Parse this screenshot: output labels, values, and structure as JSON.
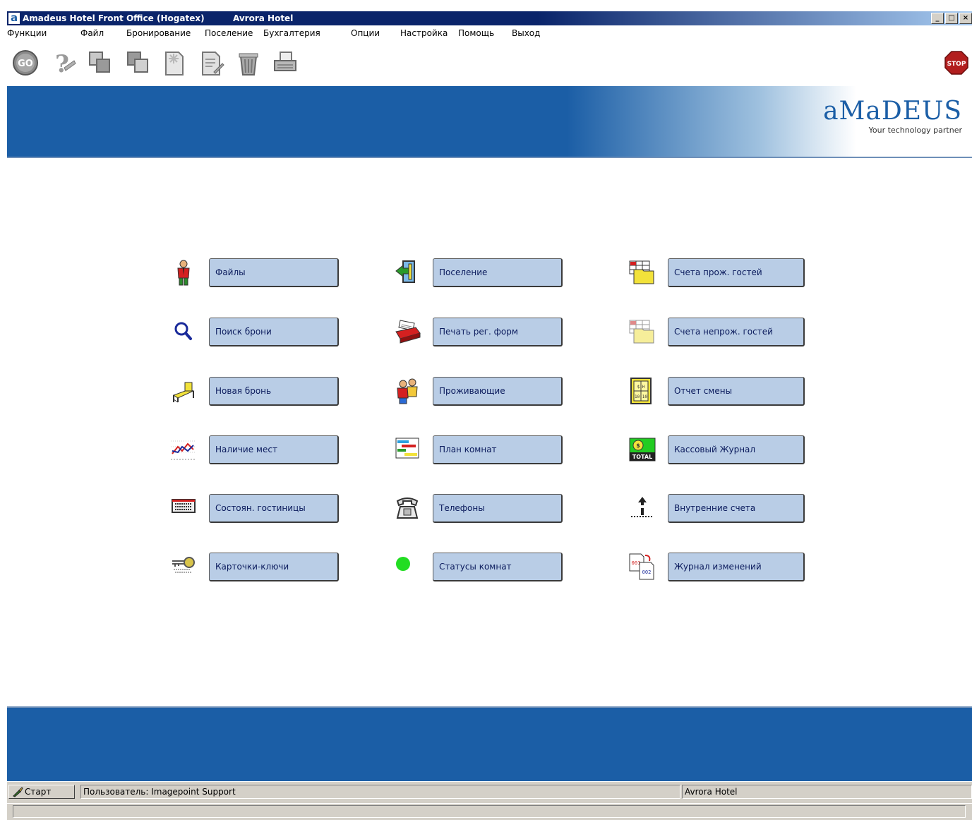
{
  "window": {
    "title": "Amadeus Hotel Front Office (Hogatex)",
    "hotel": "Avrora Hotel",
    "app_icon": "a",
    "controls": {
      "minimize": "_",
      "maximize": "□",
      "close": "×"
    }
  },
  "menu": [
    "Функции",
    "Файл",
    "Бронирование",
    "Поселение",
    "Бухгалтерия",
    "Опции",
    "Настройка",
    "Помощь",
    "Выход"
  ],
  "toolbar": {
    "go_label": "GO",
    "stop_label": "STOP",
    "icons": [
      "go-icon",
      "help-icon",
      "copy-icon",
      "paste-icon",
      "new-document-icon",
      "edit-document-icon",
      "trash-icon",
      "printer-icon",
      "stop-icon"
    ]
  },
  "brand": {
    "logo": "aMaDEUS",
    "tagline": "Your technology partner"
  },
  "main_menu": {
    "col1": [
      {
        "label": "Файлы",
        "icon": "person-icon"
      },
      {
        "label": "Поиск брони",
        "icon": "magnifier-icon"
      },
      {
        "label": "Новая бронь",
        "icon": "bed-icon"
      },
      {
        "label": "Наличие мест",
        "icon": "line-chart-icon"
      },
      {
        "label": "Состоян. гостиницы",
        "icon": "building-icon"
      },
      {
        "label": "Карточки-ключи",
        "icon": "key-icon"
      }
    ],
    "col2": [
      {
        "label": "Поселение",
        "icon": "door-icon"
      },
      {
        "label": "Печать рег. форм",
        "icon": "printer-form-icon"
      },
      {
        "label": "Проживающие",
        "icon": "guests-icon"
      },
      {
        "label": "План комнат",
        "icon": "room-plan-icon"
      },
      {
        "label": "Телефоны",
        "icon": "phone-icon"
      },
      {
        "label": "Статусы комнат",
        "icon": "green-dot-icon"
      }
    ],
    "col3": [
      {
        "label": "Счета прож. гостей",
        "icon": "folder-grid-icon"
      },
      {
        "label": "Счета непрож. гостей",
        "icon": "folder-grid-faded-icon"
      },
      {
        "label": "Отчет смены",
        "icon": "shift-report-icon"
      },
      {
        "label": "Кассовый Журнал",
        "icon": "total-icon"
      },
      {
        "label": "Внутренние счета",
        "icon": "internal-accounts-icon"
      },
      {
        "label": "Журнал изменений",
        "icon": "change-log-icon"
      }
    ]
  },
  "icon_text": {
    "shift_top": "$ H",
    "shift_bottom": "10 10",
    "total": "TOTAL",
    "total_top": "$",
    "log_a": "001",
    "log_b": "002"
  },
  "statusbar": {
    "start_label": "Старт",
    "user": "Пользователь: Imagepoint Support",
    "hotel": "Avrora Hotel"
  },
  "colors": {
    "banner_blue": "#1b5ea6",
    "button_fill": "#b9cde6",
    "titlebar": "#0a246a",
    "status_green": "#22dd22"
  }
}
